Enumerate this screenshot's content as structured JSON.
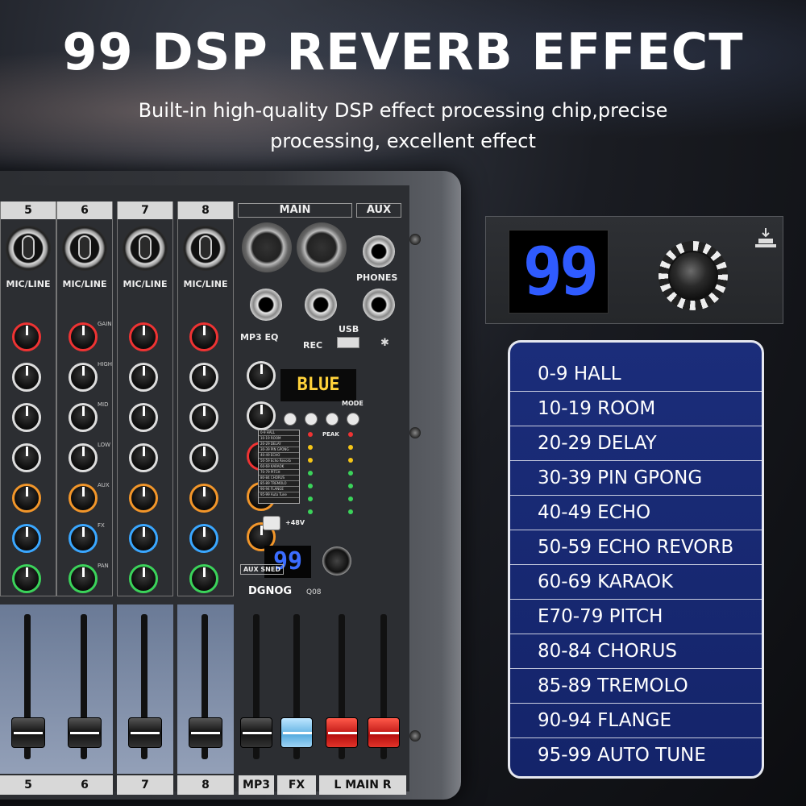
{
  "headline": "99 DSP REVERB EFFECT",
  "subline": {
    "line1": "Built-in high-quality DSP effect processing chip,precise",
    "line2": "processing, excellent effect"
  },
  "mixer": {
    "channels": [
      {
        "num": "5",
        "input_label": "MIC/LINE"
      },
      {
        "num": "6",
        "input_label": "MIC/LINE"
      },
      {
        "num": "7",
        "input_label": "MIC/LINE"
      },
      {
        "num": "8",
        "input_label": "MIC/LINE"
      }
    ],
    "knob_tags": [
      "GAIN",
      "HIGH",
      "MID",
      "LOW",
      "AUX",
      "FX",
      "PAN"
    ],
    "main_label": "MAIN",
    "aux_label": "AUX",
    "phones_label": "PHONES",
    "usb_label": "USB",
    "rec_label": "REC",
    "mp3eq_label": "MP3 EQ",
    "lcd_text": "BLUE",
    "mode_label": "MODE",
    "mini_list": [
      "0-9 HALL",
      "10-19 ROOM",
      "20-29 DELAY",
      "30-39 PIN GPONG",
      "40-49 ECHO",
      "50-59 Echo Revorb",
      "60-69 KARAOK",
      "70-79 PITCH",
      "80-84 CHORUS",
      "85-89 TREMOLO",
      "90-94 FLANGE",
      "95-99 Auto Tune"
    ],
    "peak_label": "PEAK",
    "phantom_label": "+48V",
    "aux_send_label": "AUX SNED",
    "mini_display": "99",
    "brand": "DGNOG",
    "model": "Q08",
    "fader_labels": [
      "5",
      "6",
      "7",
      "8",
      "MP3",
      "FX",
      "L MAIN R"
    ]
  },
  "zoom": {
    "display": "99",
    "push_icon": "push-button-icon"
  },
  "effects": [
    "0-9 HALL",
    "10-19 ROOM",
    "20-29 DELAY",
    "30-39 PIN GPONG",
    "40-49 ECHO",
    "50-59 ECHO REVORB",
    "60-69 KARAOK",
    "E70-79 PITCH",
    "80-84 CHORUS",
    "85-89 TREMOLO",
    "90-94 FLANGE",
    "95-99 AUTO TUNE"
  ],
  "colors": {
    "list_bg": "#1b2d7a",
    "display_blue": "#2f5bff",
    "lcd_yellow": "#ffd23a"
  }
}
